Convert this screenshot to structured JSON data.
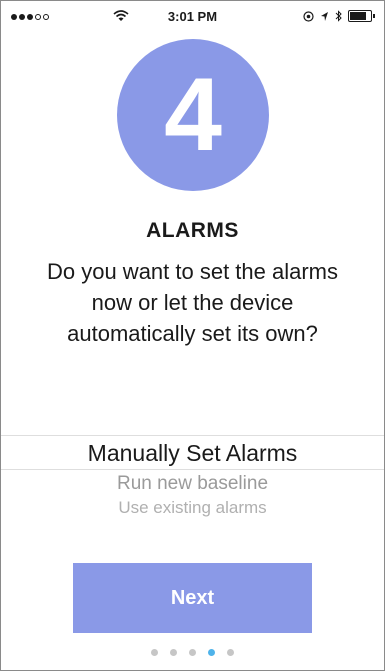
{
  "status_bar": {
    "time": "3:01 PM",
    "signal_dots_filled": 3,
    "signal_dots_total": 5,
    "icons": [
      "wifi-icon",
      "location-lock-icon",
      "location-arrow-icon",
      "bluetooth-icon",
      "battery-icon"
    ]
  },
  "step": {
    "number": "4",
    "circle_color": "#8a99e7"
  },
  "content": {
    "title": "ALARMS",
    "question": "Do you want to set the alarms now or let the device automatically set its own?"
  },
  "picker": {
    "selected": "Manually Set Alarms",
    "options": [
      "Run new baseline",
      "Use existing alarms"
    ]
  },
  "next_button": {
    "label": "Next",
    "color": "#8a99e7"
  },
  "pagination": {
    "total": 5,
    "current": 4,
    "active_color": "#4fb3ea"
  }
}
